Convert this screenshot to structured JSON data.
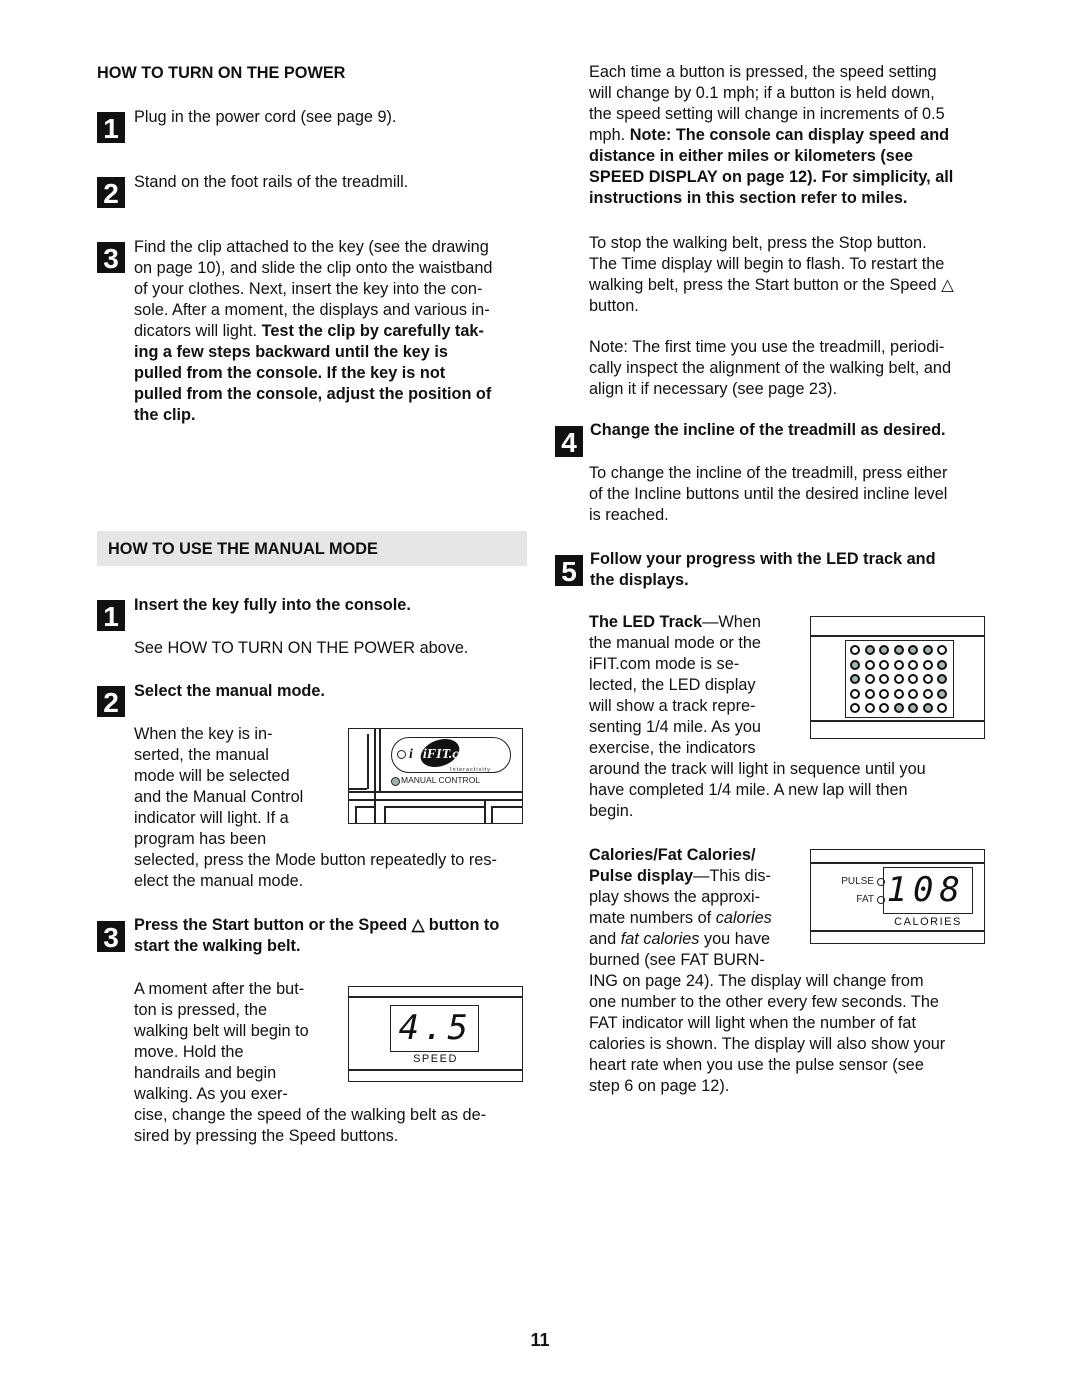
{
  "left": {
    "power_heading": "HOW TO TURN ON THE POWER",
    "power_steps": [
      {
        "number": "1",
        "text": "Plug in the power cord (see page 9)."
      },
      {
        "number": "2",
        "text": "Stand on the foot rails of the treadmill."
      },
      {
        "number": "3",
        "lines": [
          "Find the clip attached to the key (see the drawing",
          "on page 10), and slide the clip onto the waistband",
          "of your clothes. Next, insert the key into the con-",
          "sole. After a moment, the displays and various in-"
        ],
        "line5_plain": "dicators will light. ",
        "line5_bold": "Test the clip by carefully tak-",
        "bold_lines": [
          "ing a few steps backward until the key is",
          "pulled from the console. If the key is not",
          "pulled from the console, adjust the position of",
          "the clip."
        ]
      }
    ],
    "manual_heading": "HOW TO USE THE MANUAL MODE",
    "manual_steps": [
      {
        "number": "1",
        "title": "Insert the key fully into the console.",
        "body": "See HOW TO TURN ON THE POWER above."
      },
      {
        "number": "2",
        "title": "Select the manual mode.",
        "body_lines": [
          "When the key is in-",
          "serted, the manual",
          "mode will be selected",
          "and the Manual Control",
          "indicator will light. If a",
          "program has been",
          "selected, press the Mode button repeatedly to res-",
          "elect the manual mode."
        ]
      },
      {
        "number": "3",
        "title_lines": [
          "Press the Start button or the Speed △ button to",
          "start the walking belt."
        ],
        "body_lines": [
          "A moment after the but-",
          "ton is pressed, the",
          "walking belt will begin to",
          "move. Hold the",
          "handrails and begin",
          "walking. As you exer-",
          "cise, change the speed of the walking belt as de-",
          "sired by pressing the Speed buttons."
        ]
      }
    ],
    "manual_control_figure": {
      "logo_text": "iFIT.com",
      "logo_sub": "Interactivity",
      "indicator_label": "MANUAL CONTROL"
    },
    "speed_figure": {
      "value": "4.5",
      "label": "SPEED"
    }
  },
  "right": {
    "speed_para_plain": [
      "Each time a button is pressed, the speed setting",
      "will change by 0.1 mph; if a button is held down,",
      "the speed setting will change in increments of 0.5"
    ],
    "speed_para_line4_plain": "mph. ",
    "speed_para_line4_bold": "Note: The console can display speed and",
    "speed_para_bold": [
      "distance in either miles or kilometers (see",
      "SPEED DISPLAY on page 12). For simplicity, all",
      "instructions in this section refer to miles."
    ],
    "stop_para": [
      "To stop the walking belt, press the Stop button.",
      "The Time display will begin to flash. To restart the",
      "walking belt, press the Start button or the Speed △",
      "button."
    ],
    "note_para": [
      "Note: The first time you use the treadmill, periodi-",
      "cally inspect the alignment of the walking belt, and",
      "align it if necessary (see page 23)."
    ],
    "step4": {
      "number": "4",
      "title": "Change the incline of the treadmill as desired.",
      "body": [
        "To change the incline of the treadmill, press either",
        "of the Incline buttons until the desired incline level",
        "is reached."
      ]
    },
    "step5": {
      "number": "5",
      "title_lines": [
        "Follow your progress with the LED track and",
        "the displays."
      ]
    },
    "led_track": {
      "title": "The LED Track",
      "lines": [
        "—When",
        "the manual mode or the",
        "iFIT.com mode is se-",
        "lected, the LED display",
        "will show a track repre-",
        "senting 1/4 mile. As you",
        "exercise, the indicators",
        "around the track will light in sequence until you",
        "have completed 1/4 mile. A new lap will then",
        "begin."
      ],
      "grid": [
        [
          0,
          1,
          1,
          1,
          1,
          1,
          0
        ],
        [
          1,
          0,
          0,
          0,
          0,
          0,
          1
        ],
        [
          1,
          0,
          0,
          0,
          0,
          0,
          1
        ],
        [
          0,
          0,
          0,
          0,
          0,
          0,
          1
        ],
        [
          0,
          0,
          0,
          1,
          1,
          1,
          0
        ]
      ]
    },
    "calories": {
      "title_line1": "Calories/Fat Calories/",
      "title_line2": "Pulse display",
      "line2_rest": "—This dis-",
      "line3": "play shows the approxi-",
      "line4_a": "mate numbers of ",
      "line4_i": "calories",
      "line5_i": "fat calories",
      "line5_a": "and ",
      "line5_b": " you have",
      "rest": [
        "burned (see FAT BURN-",
        "ING on page 24). The display will change from",
        "one number to the other every few seconds. The",
        "FAT indicator will light when the number of fat",
        "calories is shown. The display will also show your",
        "heart rate when you use the pulse sensor (see",
        "step 6 on page 12)."
      ],
      "figure": {
        "value": "108",
        "label": "CALORIES",
        "indicators": [
          "PULSE",
          "FAT"
        ]
      }
    }
  },
  "page_number": "11"
}
